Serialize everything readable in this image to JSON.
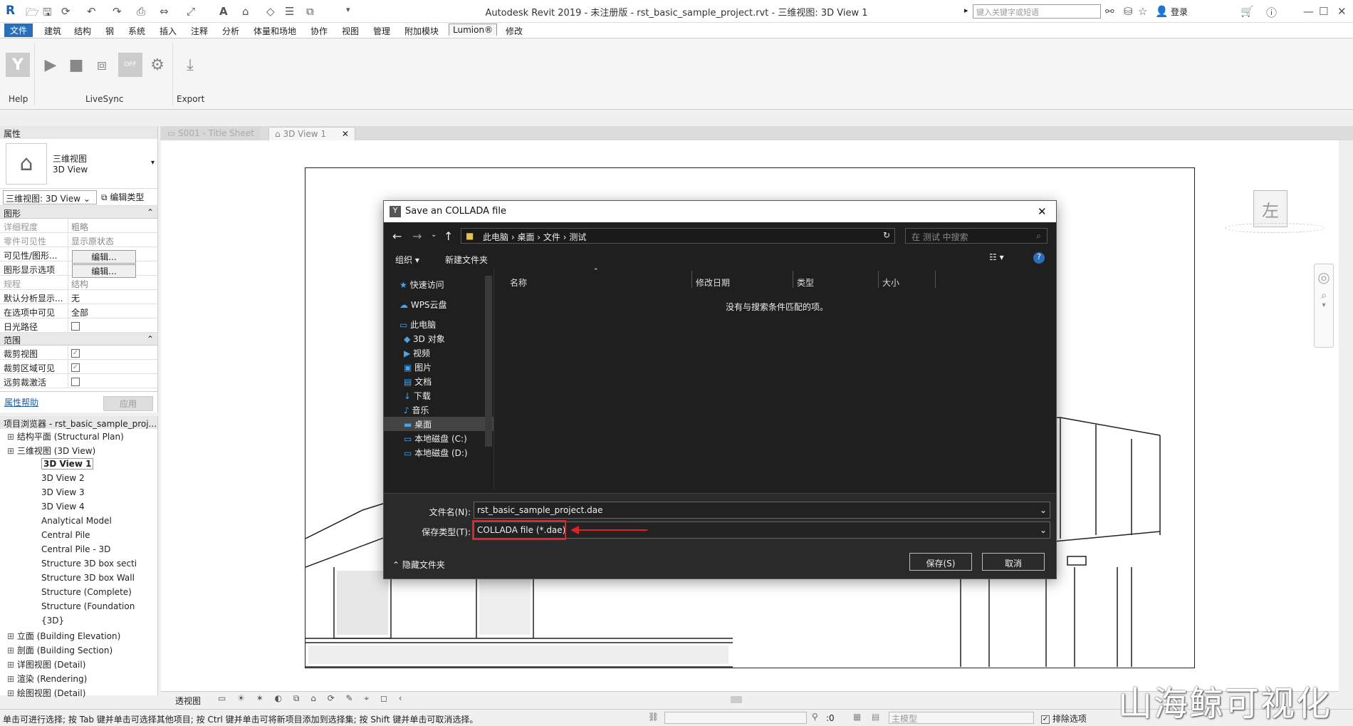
{
  "title_bar": {
    "title": "Autodesk Revit 2019 - 未注册版 - rst_basic_sample_project.rvt - 三维视图: 3D View 1",
    "search_placeholder": "键入关键字或短语",
    "login": "登录"
  },
  "ribbon_tabs": [
    "文件",
    "建筑",
    "结构",
    "钢",
    "系统",
    "插入",
    "注释",
    "分析",
    "体量和场地",
    "协作",
    "视图",
    "管理",
    "附加模块",
    "Lumion®",
    "修改"
  ],
  "ribbon_panels": {
    "help": "Help",
    "livesync": "LiveSync",
    "export": "Export",
    "off_label": "OFF"
  },
  "doc_tabs": [
    {
      "label": "S001 - Title Sheet"
    },
    {
      "label": "3D View 1"
    }
  ],
  "properties": {
    "header": "属性",
    "type_name_line1": "三维视图",
    "type_name_line2": "3D View",
    "selector": "三维视图: 3D View",
    "edit_type": "编辑类型",
    "sections": {
      "graphics": "图形",
      "extents": "范围"
    },
    "rows": [
      {
        "k": "详细程度",
        "v": "粗略",
        "dim": true
      },
      {
        "k": "零件可见性",
        "v": "显示原状态",
        "dim": true
      },
      {
        "k": "可见性/图形...",
        "v": "编辑...",
        "button": true
      },
      {
        "k": "图形显示选项",
        "v": "编辑...",
        "button": true
      },
      {
        "k": "规程",
        "v": "结构",
        "dim": true
      },
      {
        "k": "默认分析显示...",
        "v": "无"
      },
      {
        "k": "在选项中可见",
        "v": "全部"
      },
      {
        "k": "日光路径",
        "v": "",
        "check": false
      }
    ],
    "extent_rows": [
      {
        "k": "裁剪视图",
        "check": true
      },
      {
        "k": "裁剪区域可见",
        "check": true
      },
      {
        "k": "远剪裁激活",
        "check": false
      }
    ],
    "help_link": "属性帮助",
    "apply": "应用"
  },
  "browser": {
    "title": "项目浏览器 - rst_basic_sample_proj...",
    "nodes": [
      {
        "label": "结构平面 (Structural Plan)",
        "level": 1
      },
      {
        "label": "三维视图 (3D View)",
        "level": 1
      },
      {
        "label": "3D View 1",
        "level": 2,
        "bold": true
      },
      {
        "label": "3D View 2",
        "level": 2
      },
      {
        "label": "3D View 3",
        "level": 2
      },
      {
        "label": "3D View 4",
        "level": 2
      },
      {
        "label": "Analytical Model",
        "level": 2
      },
      {
        "label": "Central Pile",
        "level": 2
      },
      {
        "label": "Central Pile - 3D",
        "level": 2
      },
      {
        "label": "Structure 3D box secti",
        "level": 2
      },
      {
        "label": "Structure 3D box Wall",
        "level": 2
      },
      {
        "label": "Structure (Complete)",
        "level": 2
      },
      {
        "label": "Structure (Foundation",
        "level": 2
      },
      {
        "label": "{3D}",
        "level": 2
      },
      {
        "label": "立面 (Building Elevation)",
        "level": 1
      },
      {
        "label": "剖面 (Building Section)",
        "level": 1
      },
      {
        "label": "详图视图 (Detail)",
        "level": 1
      },
      {
        "label": "渲染 (Rendering)",
        "level": 1
      },
      {
        "label": "绘图视图 (Detail)",
        "level": 1
      }
    ]
  },
  "view_cube_label": "左",
  "view_control": {
    "mode": "透视图"
  },
  "status": {
    "text": "单击可进行选择; 按 Tab 键并单击可选择其他项目; 按 Ctrl 键并单击可将新项目添加到选择集; 按 Shift 键并单击可取消选择。",
    "zero": ":0",
    "model": "主模型",
    "exclude": "排除选项"
  },
  "dialog": {
    "title": "Save an COLLADA file",
    "breadcrumb": [
      "此电脑",
      "桌面",
      "文件",
      "测试"
    ],
    "search_placeholder": "在 测试 中搜索",
    "organize": "组织 ▾",
    "new_folder": "新建文件夹",
    "nav": [
      {
        "label": "快速访问",
        "icon": "star-icon"
      },
      {
        "label": "WPS云盘",
        "icon": "cloud-icon"
      },
      {
        "label": "此电脑",
        "icon": "computer-icon"
      },
      {
        "label": "3D 对象",
        "icon": "cube-icon"
      },
      {
        "label": "视频",
        "icon": "video-icon"
      },
      {
        "label": "图片",
        "icon": "picture-icon"
      },
      {
        "label": "文档",
        "icon": "document-icon"
      },
      {
        "label": "下载",
        "icon": "download-icon"
      },
      {
        "label": "音乐",
        "icon": "music-icon"
      },
      {
        "label": "桌面",
        "icon": "desktop-icon",
        "selected": true
      },
      {
        "label": "本地磁盘 (C:)",
        "icon": "drive-icon"
      },
      {
        "label": "本地磁盘 (D:)",
        "icon": "drive-icon"
      }
    ],
    "columns": [
      "名称",
      "修改日期",
      "类型",
      "大小"
    ],
    "empty_message": "没有与搜索条件匹配的项。",
    "filename_label": "文件名(N):",
    "filename_value": "rst_basic_sample_project.dae",
    "filetype_label": "保存类型(T):",
    "filetype_value": "COLLADA file (*.dae)",
    "hide_folders": "隐藏文件夹",
    "save": "保存(S)",
    "cancel": "取消"
  },
  "colors": {
    "accent": "#2a6ebb",
    "annotation": "#e0202a"
  },
  "watermark": "山海鲸可视化"
}
